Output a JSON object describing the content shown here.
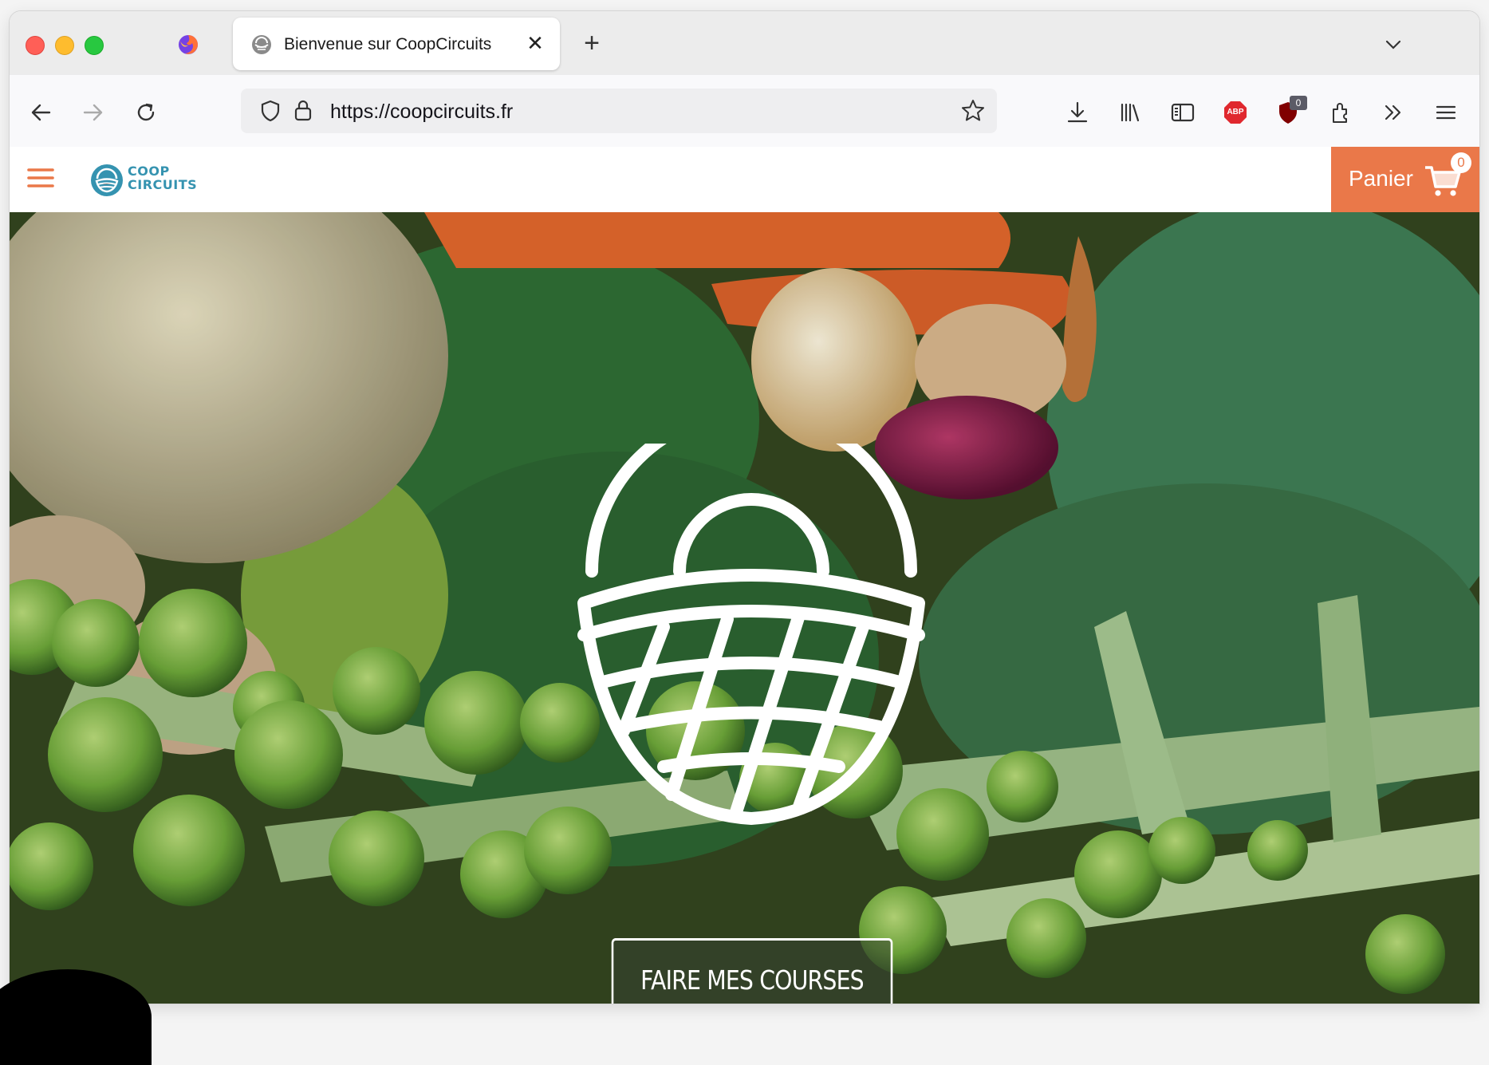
{
  "browser": {
    "tab": {
      "title": "Bienvenue sur CoopCircuits",
      "close_glyph": "✕"
    },
    "new_tab_glyph": "+",
    "url": "https://coopcircuits.fr",
    "extensions": {
      "abp_label": "ABP",
      "ublock_badge": "0"
    },
    "icons": [
      "firefox-icon",
      "back-icon",
      "forward-icon",
      "reload-icon",
      "shield-icon",
      "lock-icon",
      "bookmark-star-icon",
      "download-icon",
      "library-icon",
      "sidebar-icon",
      "adblock-plus-icon",
      "ublock-icon",
      "extensions-icon",
      "overflow-chevron-icon",
      "app-menu-icon"
    ]
  },
  "site": {
    "logo_line1": "COOP",
    "logo_line2": "CIRCUITS",
    "cart": {
      "label": "Panier",
      "count": "0"
    },
    "hero": {
      "cta_label": "FAIRE MES COURSES"
    },
    "colors": {
      "brand_orange": "#ea7849",
      "brand_blue": "#3593b0"
    }
  }
}
